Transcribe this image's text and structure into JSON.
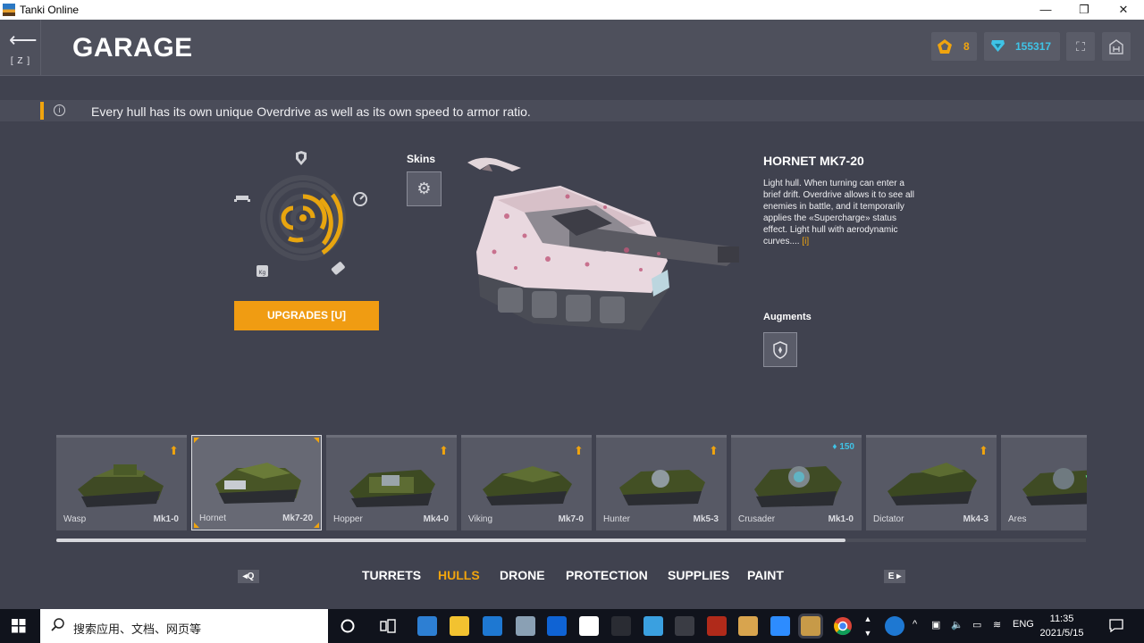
{
  "window": {
    "title": "Tanki Online",
    "minimize": "—",
    "maximize": "❐",
    "close": "✕"
  },
  "topbar": {
    "back_key": "[ Z ]",
    "title": "GARAGE",
    "crystals_small": "8",
    "crystals": "155317",
    "accent_gold": "#f0a40e",
    "accent_blue": "#3fc3e6"
  },
  "tip": {
    "text": "Every hull has its own unique Overdrive as well as its own speed to armor ratio."
  },
  "upgrades_button": "UPGRADES [U]",
  "skins_label": "Skins",
  "hull": {
    "name": "HORNET MK7-20",
    "description": "Light hull. When turning can enter a brief drift. Overdrive allows it to see all enemies in battle, and it temporarily applies the «Supercharge» status effect. Light hull with aerodynamic curves....",
    "more_link": "[i]"
  },
  "augments_label": "Augments",
  "hulls": [
    {
      "name": "Wasp",
      "mk": "Mk1-0",
      "badge": "upgrade"
    },
    {
      "name": "Hornet",
      "mk": "Mk7-20",
      "badge": "selected"
    },
    {
      "name": "Hopper",
      "mk": "Mk4-0",
      "badge": "upgrade"
    },
    {
      "name": "Viking",
      "mk": "Mk7-0",
      "badge": "upgrade"
    },
    {
      "name": "Hunter",
      "mk": "Mk5-3",
      "badge": "upgrade"
    },
    {
      "name": "Crusader",
      "mk": "Mk1-0",
      "badge": "price",
      "price": "150"
    },
    {
      "name": "Dictator",
      "mk": "Mk4-3",
      "badge": "upgrade"
    },
    {
      "name": "Ares",
      "mk": "",
      "badge": "none"
    }
  ],
  "categories": {
    "prev_key": "◂Q",
    "next_key": "E ▸",
    "items": [
      "TURRETS",
      "HULLS",
      "DRONE",
      "PROTECTION",
      "SUPPLIES",
      "PAINT"
    ],
    "active": "HULLS"
  },
  "taskbar": {
    "search_placeholder": "搜索应用、文档、网页等",
    "language": "ENG",
    "time": "11:35",
    "date": "2021/5/15"
  }
}
